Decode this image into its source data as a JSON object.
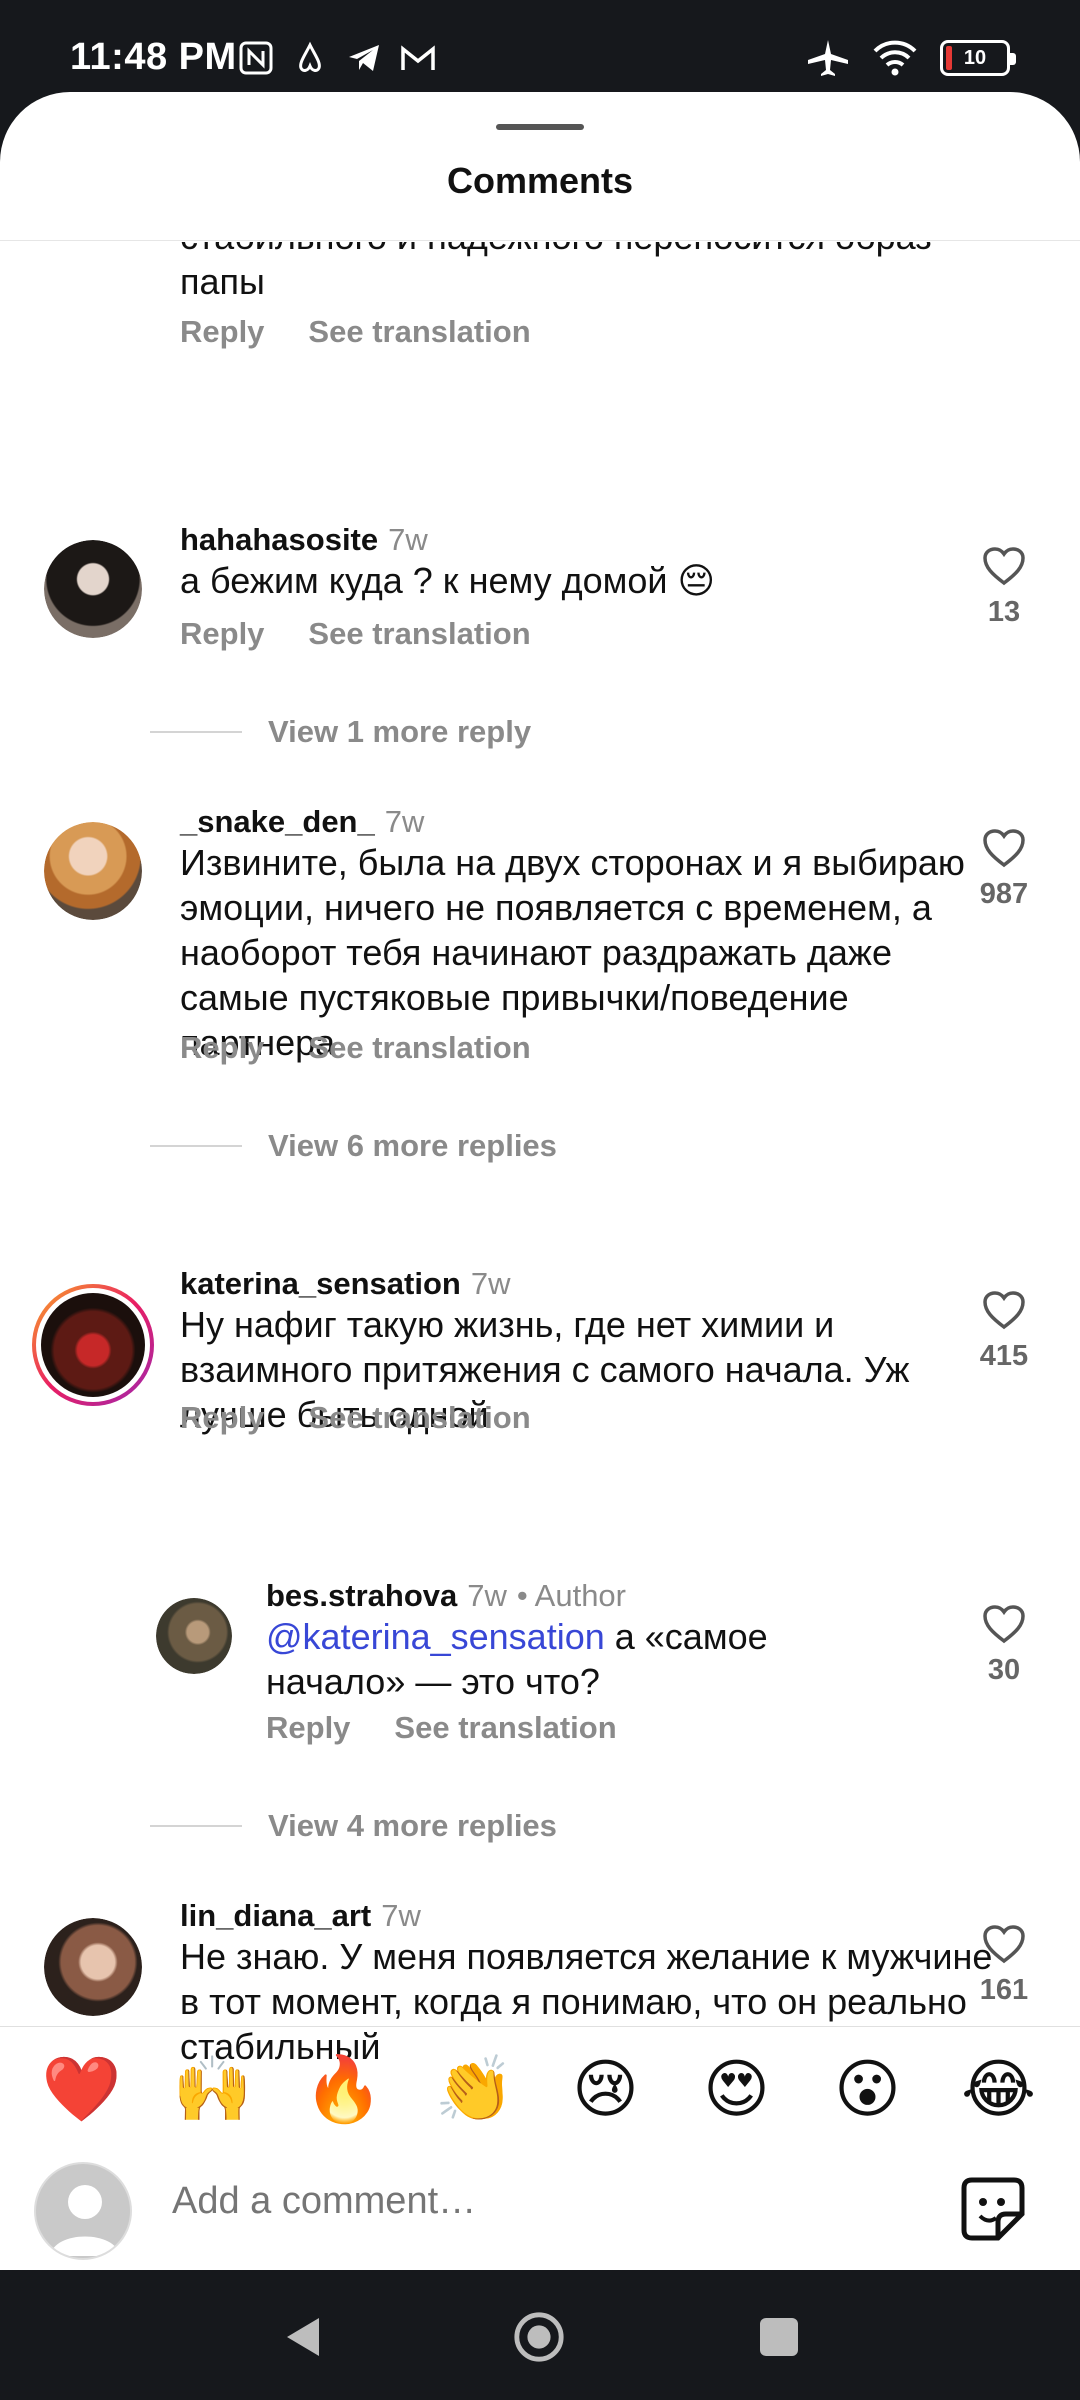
{
  "status": {
    "time": "11:48 PM",
    "battery": "10",
    "icons": [
      "nfc-icon",
      "airbnb-icon",
      "telegram-icon",
      "gmail-icon",
      "airplane-mode-icon",
      "wifi-icon",
      "battery-icon"
    ]
  },
  "sheet": {
    "title": "Comments"
  },
  "comments": [
    {
      "text": "стабильного и надежного переносится образ папы",
      "reply": "Reply",
      "translate": "See translation"
    },
    {
      "username": "hahahasosite",
      "time": "7w",
      "text": "а бежим куда ? к нему домой 😔",
      "reply": "Reply",
      "translate": "See translation",
      "likes": "13",
      "more": "View 1 more reply"
    },
    {
      "username": "_snake_den_",
      "time": "7w",
      "text": "Извините, была на двух сторонах и я выбираю эмоции, ничего не появляется с временем, а наоборот тебя начинают раздражать даже самые пустяковые привычки/поведение партнера",
      "reply": "Reply",
      "translate": "See translation",
      "likes": "987",
      "more": "View 6 more replies"
    },
    {
      "username": "katerina_sensation",
      "time": "7w",
      "text": "Ну нафиг такую жизнь, где нет химии и взаимного притяжения с самого начала. Уж лучше быть одной",
      "reply": "Reply",
      "translate": "See translation",
      "likes": "415"
    },
    {
      "username": "bes.strahova",
      "time": "7w",
      "author": "• Author",
      "mention": "@katerina_sensation",
      "text": " а «самое начало» — это что?",
      "reply": "Reply",
      "translate": "See translation",
      "likes": "30",
      "more": "View 4 more replies"
    },
    {
      "username": "lin_diana_art",
      "time": "7w",
      "text": "Не знаю. У меня появляется желание к мужчине в тот момент, когда я понимаю, что он реально стабильный",
      "likes": "161"
    }
  ],
  "reactions": [
    "❤️",
    "🙌",
    "🔥",
    "👏",
    "😢",
    "😍",
    "😮",
    "😂"
  ],
  "composer": {
    "placeholder": "Add a comment…"
  }
}
